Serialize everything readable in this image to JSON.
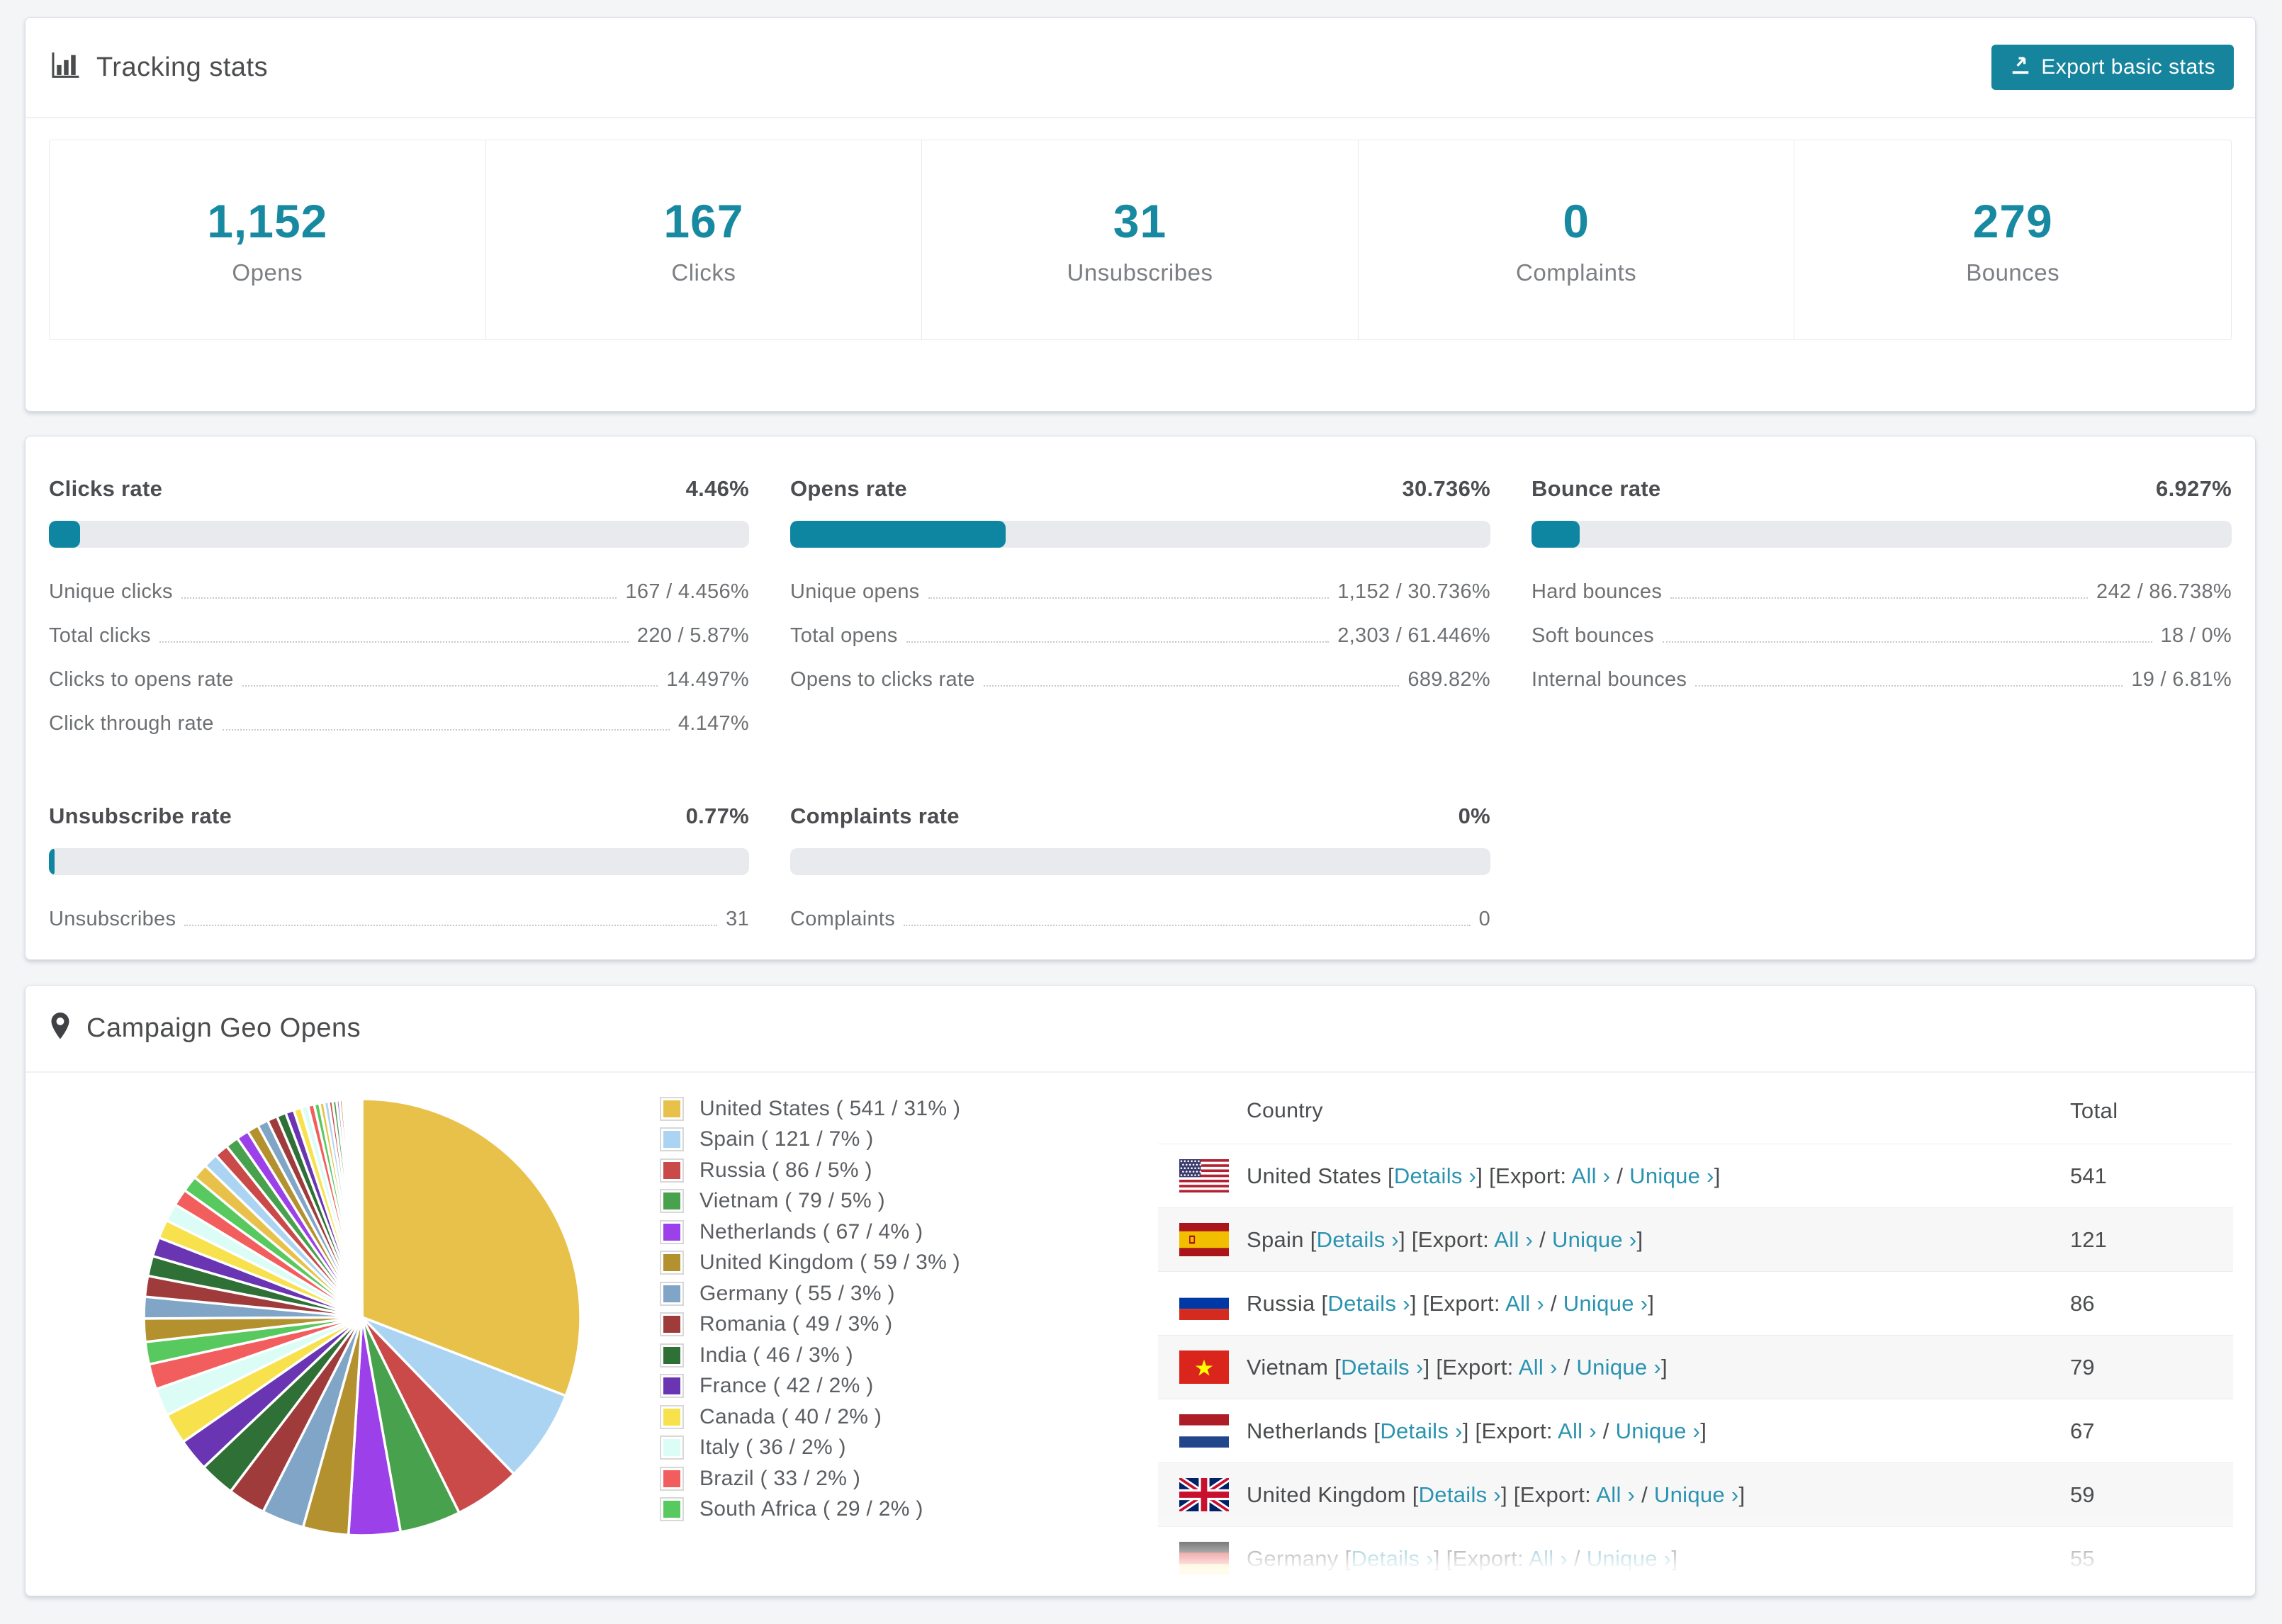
{
  "accent": "#1789a1",
  "tracking": {
    "title": "Tracking stats",
    "export_label": "Export basic stats",
    "metrics": [
      {
        "value": "1,152",
        "label": "Opens"
      },
      {
        "value": "167",
        "label": "Clicks"
      },
      {
        "value": "31",
        "label": "Unsubscribes"
      },
      {
        "value": "0",
        "label": "Complaints"
      },
      {
        "value": "279",
        "label": "Bounces"
      }
    ]
  },
  "rates": {
    "blocks": [
      {
        "title": "Clicks rate",
        "value": "4.46%",
        "percent": 4.46,
        "rows": [
          {
            "label": "Unique clicks",
            "value": "167 / 4.456%"
          },
          {
            "label": "Total clicks",
            "value": "220 / 5.87%"
          },
          {
            "label": "Clicks to opens rate",
            "value": "14.497%"
          },
          {
            "label": "Click through rate",
            "value": "4.147%"
          }
        ]
      },
      {
        "title": "Opens rate",
        "value": "30.736%",
        "percent": 30.736,
        "rows": [
          {
            "label": "Unique opens",
            "value": "1,152 / 30.736%"
          },
          {
            "label": "Total opens",
            "value": "2,303 / 61.446%"
          },
          {
            "label": "Opens to clicks rate",
            "value": "689.82%"
          }
        ]
      },
      {
        "title": "Bounce rate",
        "value": "6.927%",
        "percent": 6.927,
        "rows": [
          {
            "label": "Hard bounces",
            "value": "242 / 86.738%"
          },
          {
            "label": "Soft bounces",
            "value": "18 / 0%"
          },
          {
            "label": "Internal bounces",
            "value": "19 / 6.81%"
          }
        ]
      },
      {
        "title": "Unsubscribe rate",
        "value": "0.77%",
        "percent": 0.77,
        "rows": [
          {
            "label": "Unsubscribes",
            "value": "31"
          }
        ]
      },
      {
        "title": "Complaints rate",
        "value": "0%",
        "percent": 0,
        "rows": [
          {
            "label": "Complaints",
            "value": "0"
          }
        ]
      }
    ]
  },
  "geo": {
    "title": "Campaign Geo Opens",
    "table": {
      "country_header": "Country",
      "total_header": "Total",
      "link_labels": {
        "details": "Details ›",
        "export": "[Export: ",
        "all": "All ›",
        "slash": " / ",
        "unique": "Unique ›",
        "open": "[",
        "close": "]",
        "close2": "]"
      },
      "rows": [
        {
          "flag": "us",
          "country": "United States",
          "total": "541"
        },
        {
          "flag": "es",
          "country": "Spain",
          "total": "121"
        },
        {
          "flag": "ru",
          "country": "Russia",
          "total": "86"
        },
        {
          "flag": "vn",
          "country": "Vietnam",
          "total": "79"
        },
        {
          "flag": "nl",
          "country": "Netherlands",
          "total": "67"
        },
        {
          "flag": "gb",
          "country": "United Kingdom",
          "total": "59"
        },
        {
          "flag": "de",
          "country": "Germany",
          "total": "55"
        }
      ]
    }
  },
  "chart_data": {
    "type": "pie",
    "title": "Campaign Geo Opens",
    "legend_position": "right",
    "slices": [
      {
        "name": "United States",
        "value": 541,
        "pct": 31,
        "color": "#e7c149"
      },
      {
        "name": "Spain",
        "value": 121,
        "pct": 7,
        "color": "#abd4f3"
      },
      {
        "name": "Russia",
        "value": 86,
        "pct": 5,
        "color": "#ca4a4a"
      },
      {
        "name": "Vietnam",
        "value": 79,
        "pct": 5,
        "color": "#48a14c"
      },
      {
        "name": "Netherlands",
        "value": 67,
        "pct": 4,
        "color": "#9c40ea"
      },
      {
        "name": "United Kingdom",
        "value": 59,
        "pct": 3,
        "color": "#b3912e"
      },
      {
        "name": "Germany",
        "value": 55,
        "pct": 3,
        "color": "#80a5c6"
      },
      {
        "name": "Romania",
        "value": 49,
        "pct": 3,
        "color": "#a03b3b"
      },
      {
        "name": "India",
        "value": 46,
        "pct": 3,
        "color": "#2f7036"
      },
      {
        "name": "France",
        "value": 42,
        "pct": 2,
        "color": "#6a35b2"
      },
      {
        "name": "Canada",
        "value": 40,
        "pct": 2,
        "color": "#f7e24d"
      },
      {
        "name": "Italy",
        "value": 36,
        "pct": 2,
        "color": "#dbfdf5"
      },
      {
        "name": "Brazil",
        "value": 33,
        "pct": 2,
        "color": "#f25e5e"
      },
      {
        "name": "South Africa",
        "value": 29,
        "pct": 2,
        "color": "#58c95e"
      }
    ],
    "other_slices_estimated": [
      30,
      28,
      27,
      26,
      25,
      24,
      23,
      22,
      21,
      20,
      19,
      18,
      17,
      16,
      15,
      14,
      13,
      12,
      11,
      10,
      9,
      8,
      7,
      6,
      6,
      5,
      5,
      4,
      4,
      3,
      3,
      3,
      2,
      2,
      2,
      2,
      1,
      1,
      1,
      1,
      1,
      1,
      1,
      1
    ]
  }
}
